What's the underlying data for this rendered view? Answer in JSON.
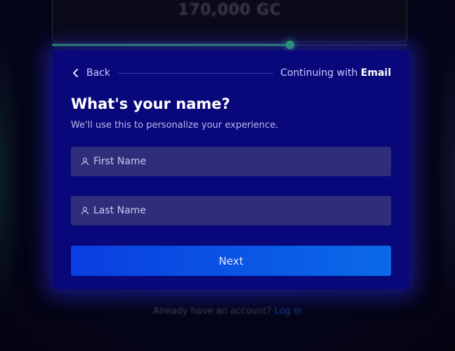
{
  "background": {
    "amount_text": "170,000 GC",
    "progress_fraction": 0.67,
    "prompt_text": "Already have an account?",
    "login_link": "Log in"
  },
  "modal": {
    "back_label": "Back",
    "continuing_prefix": "Continuing with",
    "continuing_method": "Email",
    "title": "What's your name?",
    "subtitle": "We'll use this to personalize your experience.",
    "first_name": {
      "placeholder": "First Name",
      "value": ""
    },
    "last_name": {
      "placeholder": "Last Name",
      "value": ""
    },
    "next_label": "Next"
  },
  "colors": {
    "modal_bg": "#08087a",
    "field_bg": "#2e2e7a",
    "button_start": "#0a3ee0",
    "button_end": "#0a6ae8",
    "progress_accent": "#2fbf5a"
  },
  "icons": {
    "back": "chevron-left-icon",
    "field": "person-icon"
  }
}
